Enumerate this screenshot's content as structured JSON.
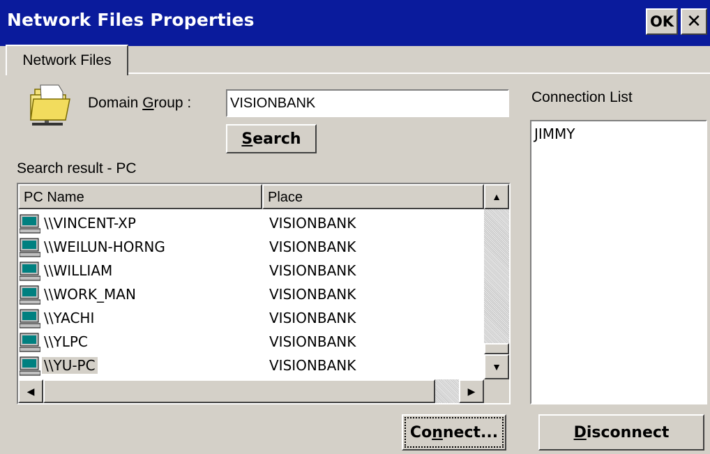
{
  "window": {
    "title": "Network Files Properties",
    "ok_label": "OK",
    "close_label": "✕",
    "title_color": "#0a1b9c"
  },
  "tabs": [
    {
      "label": "Network Files",
      "active": true
    }
  ],
  "domain": {
    "label_prefix": "Domain ",
    "label_mnemonic": "G",
    "label_suffix": "roup :",
    "value": "VISIONBANK",
    "icon": "network-folder-icon"
  },
  "search": {
    "label_mnemonic": "S",
    "label_rest": "earch"
  },
  "results": {
    "heading": "Search result - PC",
    "columns": [
      "PC Name",
      "Place"
    ],
    "rows": [
      {
        "name": "\\\\VINCENT-XP",
        "place": "VISIONBANK"
      },
      {
        "name": "\\\\WEILUN-HORNG",
        "place": "VISIONBANK"
      },
      {
        "name": "\\\\WILLIAM",
        "place": "VISIONBANK"
      },
      {
        "name": "\\\\WORK_MAN",
        "place": "VISIONBANK"
      },
      {
        "name": "\\\\YACHI",
        "place": "VISIONBANK"
      },
      {
        "name": "\\\\YLPC",
        "place": "VISIONBANK"
      },
      {
        "name": "\\\\YU-PC",
        "place": "VISIONBANK"
      }
    ],
    "selected_row": "\\\\YU-PC",
    "row_icon": "computer-icon"
  },
  "connection_list": {
    "heading": "Connection List",
    "items": [
      "JIMMY"
    ]
  },
  "connect_button": {
    "label_prefix": "Co",
    "label_mnemonic": "n",
    "label_suffix": "nect..."
  },
  "disconnect_button": {
    "label_mnemonic": "D",
    "label_rest": "isconnect"
  },
  "scroll": {
    "up": "▲",
    "down": "▼",
    "left": "◀",
    "right": "▶"
  }
}
